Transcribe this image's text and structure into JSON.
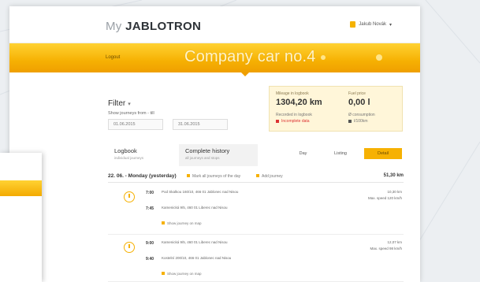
{
  "header": {
    "logo_prefix": "My",
    "logo_brand": "JABLOTRON",
    "user_name": "Jakub Novák"
  },
  "yellow_bar": {
    "left_link": "Logout",
    "title": "Company car no.4"
  },
  "filter": {
    "title": "Filter",
    "subtitle": "Show journeys from - till",
    "date_from": "01.06.2015",
    "date_to": "31.06.2015"
  },
  "summary": {
    "mileage_label": "Mileage in logbook",
    "mileage_value": "1304,20 km",
    "fuel_label": "Fuel price",
    "fuel_value": "0,00 l",
    "recorded_label": "Recorded in logbook",
    "missing_label": "Incomplete data",
    "consumption_label": "Ø consumption",
    "unit_label": "l/100km"
  },
  "tabs": [
    {
      "title": "Logbook",
      "subtitle": "individual journeys"
    },
    {
      "title": "Complete history",
      "subtitle": "all journeys and stops"
    }
  ],
  "segments": [
    "Day",
    "Listing",
    "Detail"
  ],
  "day": {
    "heading": "22. 06. - Monday (yesterday)",
    "link1": "Mark all journeys of the day",
    "link2": "Add journey",
    "distance": "51,30 km"
  },
  "trips": [
    {
      "time1": "7:00",
      "addr1": "Pod Skalkou 160/10, 466 01 Jablonec nad Nisou",
      "time2": "7:45",
      "addr2": "Kamenická 9/5, 460 01 Liberec nad Nisou",
      "more": "Show journey on map",
      "right1": "10,30 km",
      "right2": "Max. speed 120 km/h"
    },
    {
      "time1": "9:00",
      "addr1": "Kamenická 9/5, 460 01 Liberec nad Nisou",
      "time2": "9:40",
      "addr2": "Kostelní 200/10, 466 01 Jablonec nad Nisou",
      "more": "Show journey on map",
      "right1": "12,07 km",
      "right2": "Max. speed 98 km/h"
    }
  ],
  "colors": {
    "accent": "#f6b103",
    "accent_light": "#ffd233",
    "summary_bg": "#fff6d9",
    "background": "#eceff2"
  },
  "icons": [
    "lock-icon",
    "chevron-down-icon",
    "gear-icon",
    "clock-icon",
    "info-icon"
  ]
}
